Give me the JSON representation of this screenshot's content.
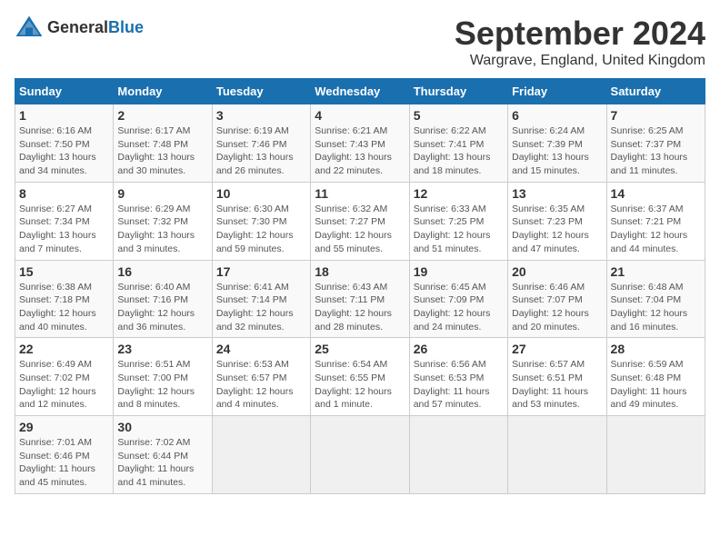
{
  "header": {
    "logo_general": "General",
    "logo_blue": "Blue",
    "title": "September 2024",
    "subtitle": "Wargrave, England, United Kingdom"
  },
  "days_of_week": [
    "Sunday",
    "Monday",
    "Tuesday",
    "Wednesday",
    "Thursday",
    "Friday",
    "Saturday"
  ],
  "weeks": [
    [
      {
        "day": "1",
        "info": "Sunrise: 6:16 AM\nSunset: 7:50 PM\nDaylight: 13 hours and 34 minutes."
      },
      {
        "day": "2",
        "info": "Sunrise: 6:17 AM\nSunset: 7:48 PM\nDaylight: 13 hours and 30 minutes."
      },
      {
        "day": "3",
        "info": "Sunrise: 6:19 AM\nSunset: 7:46 PM\nDaylight: 13 hours and 26 minutes."
      },
      {
        "day": "4",
        "info": "Sunrise: 6:21 AM\nSunset: 7:43 PM\nDaylight: 13 hours and 22 minutes."
      },
      {
        "day": "5",
        "info": "Sunrise: 6:22 AM\nSunset: 7:41 PM\nDaylight: 13 hours and 18 minutes."
      },
      {
        "day": "6",
        "info": "Sunrise: 6:24 AM\nSunset: 7:39 PM\nDaylight: 13 hours and 15 minutes."
      },
      {
        "day": "7",
        "info": "Sunrise: 6:25 AM\nSunset: 7:37 PM\nDaylight: 13 hours and 11 minutes."
      }
    ],
    [
      {
        "day": "8",
        "info": "Sunrise: 6:27 AM\nSunset: 7:34 PM\nDaylight: 13 hours and 7 minutes."
      },
      {
        "day": "9",
        "info": "Sunrise: 6:29 AM\nSunset: 7:32 PM\nDaylight: 13 hours and 3 minutes."
      },
      {
        "day": "10",
        "info": "Sunrise: 6:30 AM\nSunset: 7:30 PM\nDaylight: 12 hours and 59 minutes."
      },
      {
        "day": "11",
        "info": "Sunrise: 6:32 AM\nSunset: 7:27 PM\nDaylight: 12 hours and 55 minutes."
      },
      {
        "day": "12",
        "info": "Sunrise: 6:33 AM\nSunset: 7:25 PM\nDaylight: 12 hours and 51 minutes."
      },
      {
        "day": "13",
        "info": "Sunrise: 6:35 AM\nSunset: 7:23 PM\nDaylight: 12 hours and 47 minutes."
      },
      {
        "day": "14",
        "info": "Sunrise: 6:37 AM\nSunset: 7:21 PM\nDaylight: 12 hours and 44 minutes."
      }
    ],
    [
      {
        "day": "15",
        "info": "Sunrise: 6:38 AM\nSunset: 7:18 PM\nDaylight: 12 hours and 40 minutes."
      },
      {
        "day": "16",
        "info": "Sunrise: 6:40 AM\nSunset: 7:16 PM\nDaylight: 12 hours and 36 minutes."
      },
      {
        "day": "17",
        "info": "Sunrise: 6:41 AM\nSunset: 7:14 PM\nDaylight: 12 hours and 32 minutes."
      },
      {
        "day": "18",
        "info": "Sunrise: 6:43 AM\nSunset: 7:11 PM\nDaylight: 12 hours and 28 minutes."
      },
      {
        "day": "19",
        "info": "Sunrise: 6:45 AM\nSunset: 7:09 PM\nDaylight: 12 hours and 24 minutes."
      },
      {
        "day": "20",
        "info": "Sunrise: 6:46 AM\nSunset: 7:07 PM\nDaylight: 12 hours and 20 minutes."
      },
      {
        "day": "21",
        "info": "Sunrise: 6:48 AM\nSunset: 7:04 PM\nDaylight: 12 hours and 16 minutes."
      }
    ],
    [
      {
        "day": "22",
        "info": "Sunrise: 6:49 AM\nSunset: 7:02 PM\nDaylight: 12 hours and 12 minutes."
      },
      {
        "day": "23",
        "info": "Sunrise: 6:51 AM\nSunset: 7:00 PM\nDaylight: 12 hours and 8 minutes."
      },
      {
        "day": "24",
        "info": "Sunrise: 6:53 AM\nSunset: 6:57 PM\nDaylight: 12 hours and 4 minutes."
      },
      {
        "day": "25",
        "info": "Sunrise: 6:54 AM\nSunset: 6:55 PM\nDaylight: 12 hours and 1 minute."
      },
      {
        "day": "26",
        "info": "Sunrise: 6:56 AM\nSunset: 6:53 PM\nDaylight: 11 hours and 57 minutes."
      },
      {
        "day": "27",
        "info": "Sunrise: 6:57 AM\nSunset: 6:51 PM\nDaylight: 11 hours and 53 minutes."
      },
      {
        "day": "28",
        "info": "Sunrise: 6:59 AM\nSunset: 6:48 PM\nDaylight: 11 hours and 49 minutes."
      }
    ],
    [
      {
        "day": "29",
        "info": "Sunrise: 7:01 AM\nSunset: 6:46 PM\nDaylight: 11 hours and 45 minutes."
      },
      {
        "day": "30",
        "info": "Sunrise: 7:02 AM\nSunset: 6:44 PM\nDaylight: 11 hours and 41 minutes."
      },
      {
        "day": "",
        "info": ""
      },
      {
        "day": "",
        "info": ""
      },
      {
        "day": "",
        "info": ""
      },
      {
        "day": "",
        "info": ""
      },
      {
        "day": "",
        "info": ""
      }
    ]
  ]
}
